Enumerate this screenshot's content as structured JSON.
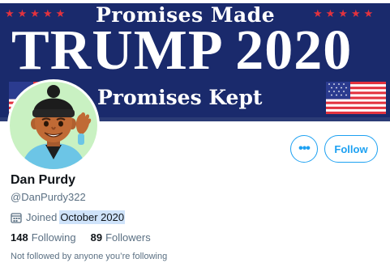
{
  "banner": {
    "stars_left": "★★★★★",
    "stars_right": "★★★★★",
    "line1": "Promises Made",
    "line2": "TRUMP 2020",
    "line3": "Promises Kept",
    "colors": {
      "navy": "#1a2a6c",
      "red": "#e3323e",
      "white": "#ffffff"
    }
  },
  "profile": {
    "avatar_icon": "memoji-avatar",
    "display_name": "Dan Purdy",
    "handle": "@DanPurdy322",
    "joined_prefix": "Joined",
    "joined_date": "October 2020",
    "following_count": "148",
    "following_label": "Following",
    "followers_count": "89",
    "followers_label": "Followers",
    "not_followed_text": "Not followed by anyone you’re following"
  },
  "actions": {
    "more_label": "•••",
    "follow_label": "Follow",
    "accent_color": "#1da1f2"
  },
  "selection_color": "#cfe3fa"
}
